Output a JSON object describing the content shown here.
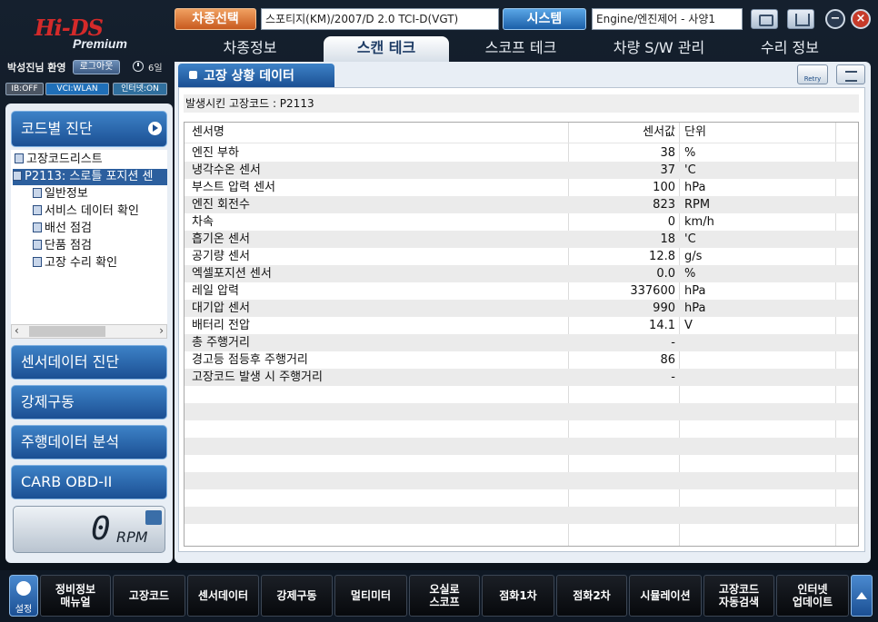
{
  "header": {
    "logo_main": "Hi-DS",
    "logo_sub": "Premium",
    "greeting": "박성진님 환영",
    "logout": "로그아웃",
    "clock": "6일",
    "status": [
      "IB:OFF",
      "VCI:WLAN",
      "인터넷:ON"
    ],
    "vehicle_select_label": "차종선택",
    "vehicle_value": "스포티지(KM)/2007/D 2.0 TCI-D(VGT)",
    "system_label": "시스템",
    "system_value": "Engine/엔진제어 - 사양1"
  },
  "tabs": [
    "차종정보",
    "스캔 테크",
    "스코프 테크",
    "차량 S/W 관리",
    "수리 정보"
  ],
  "sidebar": {
    "head": "코드별 진단",
    "tree": [
      "고장코드리스트",
      "P2113: 스로틀 포지션 센",
      "일반정보",
      "서비스 데이터 확인",
      "배선 점검",
      "단품 점검",
      "고장 수리 확인"
    ],
    "buttons": [
      "센서데이터 진단",
      "강제구동",
      "주행데이터 분석",
      "CARB OBD-II"
    ],
    "rpm_value": "0",
    "rpm_unit": "RPM"
  },
  "panel": {
    "title": "고장 상황 데이터",
    "retry": "Retry",
    "dtc_line": "발생시킨 고장코드 : P2113",
    "columns": [
      "센서명",
      "센서값",
      "단위"
    ],
    "rows": [
      [
        "엔진 부하",
        "38",
        "%"
      ],
      [
        "냉각수온 센서",
        "37",
        "'C"
      ],
      [
        "부스트 압력 센서",
        "100",
        "hPa"
      ],
      [
        "엔진 회전수",
        "823",
        "RPM"
      ],
      [
        "차속",
        "0",
        "km/h"
      ],
      [
        "흡기온 센서",
        "18",
        "'C"
      ],
      [
        "공기량 센서",
        "12.8",
        "g/s"
      ],
      [
        "엑셀포지션 센서",
        "0.0",
        "%"
      ],
      [
        "레일 압력",
        "337600",
        "hPa"
      ],
      [
        "대기압 센서",
        "990",
        "hPa"
      ],
      [
        "배터리 전압",
        "14.1",
        "V"
      ],
      [
        "총 주행거리",
        "-",
        ""
      ],
      [
        "경고등 점등후 주행거리",
        "86",
        ""
      ],
      [
        "고장코드 발생 시 주행거리",
        "-",
        ""
      ]
    ]
  },
  "bottom": {
    "settings": "설정",
    "buttons": [
      "정비정보\n매뉴얼",
      "고장코드",
      "센서데이터",
      "강제구동",
      "멀티미터",
      "오실로\n스코프",
      "점화1차",
      "점화2차",
      "시뮬레이션",
      "고장코드\n자동검색",
      "인터넷\n업데이트"
    ]
  }
}
